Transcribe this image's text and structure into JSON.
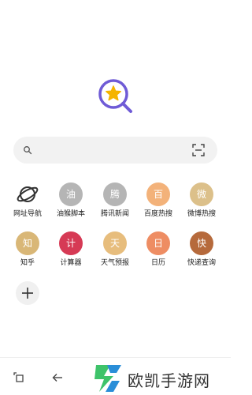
{
  "tiles": [
    {
      "label": "网址导航",
      "glyph": "",
      "color": "#ffffff",
      "icon": "planet-icon"
    },
    {
      "label": "油猴脚本",
      "glyph": "油",
      "color": "#b5b5b5",
      "icon": "oil-monkey-icon"
    },
    {
      "label": "腾讯新闻",
      "glyph": "腾",
      "color": "#b5b5b5",
      "icon": "tencent-news-icon"
    },
    {
      "label": "百度热搜",
      "glyph": "百",
      "color": "#f3b27a",
      "icon": "baidu-hot-icon"
    },
    {
      "label": "微博热搜",
      "glyph": "微",
      "color": "#dcc08a",
      "icon": "weibo-hot-icon"
    },
    {
      "label": "知乎",
      "glyph": "知",
      "color": "#d9b777",
      "icon": "zhihu-icon"
    },
    {
      "label": "计算器",
      "glyph": "计",
      "color": "#d63a55",
      "icon": "calculator-icon"
    },
    {
      "label": "天气预报",
      "glyph": "天",
      "color": "#e7bd7d",
      "icon": "weather-icon"
    },
    {
      "label": "日历",
      "glyph": "日",
      "color": "#ee8d63",
      "icon": "calendar-icon"
    },
    {
      "label": "快递查询",
      "glyph": "快",
      "color": "#b66a3c",
      "icon": "express-icon"
    }
  ],
  "colors": {
    "logo_ring": "#6f5bd6",
    "logo_star": "#f5b400",
    "search_bg": "#f2f2f2",
    "watermark_green": "#3ec36a",
    "watermark_blue": "#2a8ed8"
  },
  "watermark": {
    "text": "欧凯手游网"
  }
}
